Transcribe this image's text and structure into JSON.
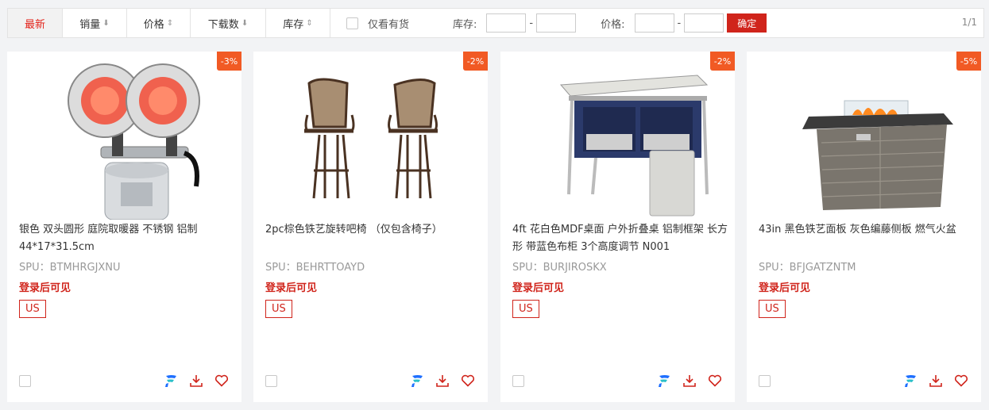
{
  "filter": {
    "sort_tabs": [
      {
        "label": "最新",
        "arrow": ""
      },
      {
        "label": "销量",
        "arrow": "⬇"
      },
      {
        "label": "价格",
        "arrow": "⇕"
      },
      {
        "label": "下载数",
        "arrow": "⬇"
      },
      {
        "label": "库存",
        "arrow": "⇕"
      }
    ],
    "only_in_stock_label": "仅看有货",
    "stock_label": "库存:",
    "price_label": "价格:",
    "range_dash": "-",
    "confirm_label": "确定",
    "page_indicator": "1/1"
  },
  "colors": {
    "accent": "#d0241b",
    "discount_bg": "#f15a24"
  },
  "products": [
    {
      "discount": "-3%",
      "title": "银色 双头圆形 庭院取暖器 不锈钢 铝制 44*17*31.5cm",
      "spu": "SPU：BTMHRGJXNU",
      "login_tip": "登录后可见",
      "region": "US",
      "image": "patio-heater-image"
    },
    {
      "discount": "-2%",
      "title": "2pc棕色铁艺旋转吧椅 （仅包含椅子）",
      "spu": "SPU：BEHRTTOAYD",
      "login_tip": "登录后可见",
      "region": "US",
      "image": "bar-chairs-image"
    },
    {
      "discount": "-2%",
      "title": "4ft 花白色MDF桌面 户外折叠桌 铝制框架 长方形 带蓝色布柜 3个高度调节 N001",
      "spu": "SPU：BURJIROSKX",
      "login_tip": "登录后可见",
      "region": "US",
      "image": "folding-table-image"
    },
    {
      "discount": "-5%",
      "title": "43in 黑色铁艺面板 灰色编藤侧板 燃气火盆",
      "spu": "SPU：BFJGATZNTM",
      "login_tip": "登录后可见",
      "region": "US",
      "image": "fire-pit-table-image"
    }
  ]
}
